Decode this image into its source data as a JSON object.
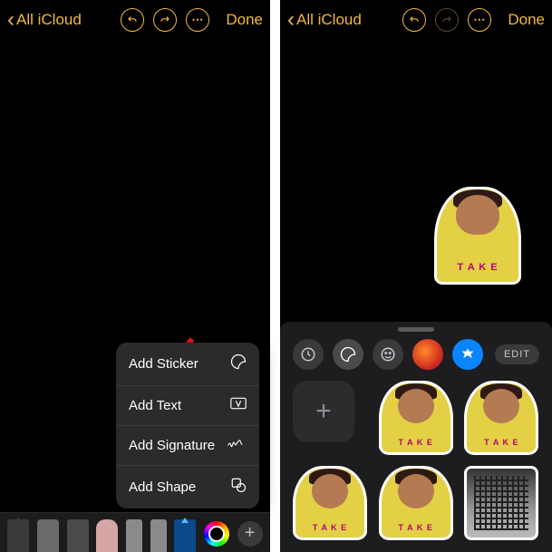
{
  "nav": {
    "back_label": "All iCloud",
    "done_label": "Done"
  },
  "popover": {
    "add_sticker": "Add Sticker",
    "add_text": "Add Text",
    "add_signature": "Add Signature",
    "add_shape": "Add Shape"
  },
  "drawer": {
    "edit_label": "EDIT",
    "sticker_text": "T A K E"
  },
  "plus_glyph": "+"
}
